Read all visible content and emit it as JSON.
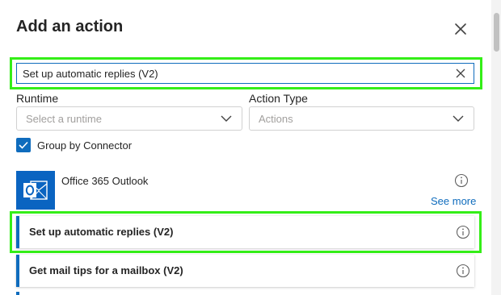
{
  "dialog": {
    "title": "Add an action"
  },
  "search": {
    "value": "Set up automatic replies (V2)"
  },
  "filters": {
    "runtime": {
      "label": "Runtime",
      "placeholder": "Select a runtime"
    },
    "action_type": {
      "label": "Action Type",
      "placeholder": "Actions"
    }
  },
  "group_by_connector": {
    "label": "Group by Connector",
    "checked": true
  },
  "connector": {
    "name": "Office 365 Outlook",
    "see_more": "See more",
    "icon": "outlook-icon"
  },
  "actions": [
    {
      "label": "Set up automatic replies (V2)"
    },
    {
      "label": "Get mail tips for a mailbox (V2)"
    }
  ],
  "colors": {
    "accent": "#0f6cbd",
    "highlight": "#34ee17",
    "connector_brand": "#0a64c1"
  }
}
